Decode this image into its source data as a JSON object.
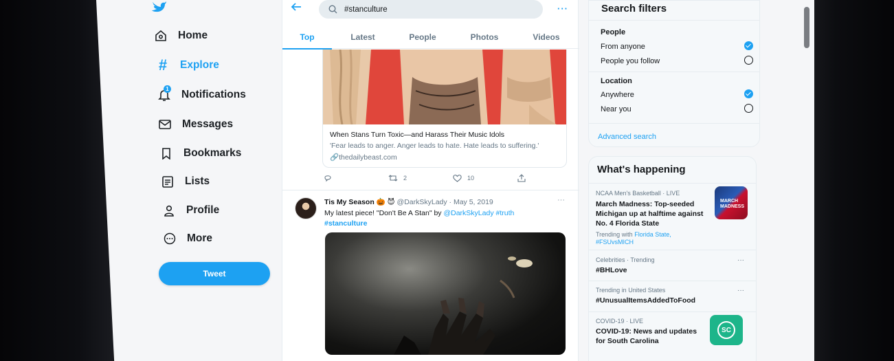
{
  "brand": {
    "accent": "#1da1f2",
    "logo_icon": "twitter-bird-icon"
  },
  "nav": {
    "items": [
      {
        "label": "Home",
        "icon": "home-icon"
      },
      {
        "label": "Explore",
        "icon": "hashtag-icon"
      },
      {
        "label": "Notifications",
        "icon": "bell-icon",
        "badge": "1"
      },
      {
        "label": "Messages",
        "icon": "envelope-icon"
      },
      {
        "label": "Bookmarks",
        "icon": "bookmark-icon"
      },
      {
        "label": "Lists",
        "icon": "list-icon"
      },
      {
        "label": "Profile",
        "icon": "person-icon"
      },
      {
        "label": "More",
        "icon": "more-circle-icon"
      }
    ],
    "tweet_label": "Tweet"
  },
  "search": {
    "value": "#stanculture",
    "more": "···"
  },
  "tabs": [
    {
      "label": "Top",
      "active": true
    },
    {
      "label": "Latest"
    },
    {
      "label": "People"
    },
    {
      "label": "Photos"
    },
    {
      "label": "Videos"
    }
  ],
  "card": {
    "title": "When Stans Turn Toxic—and Harass Their Music Idols",
    "description": "'Fear leads to anger. Anger leads to hate. Hate leads to suffering.'",
    "link": "thedailybeast.com"
  },
  "actions": {
    "retweets": "2",
    "likes": "10"
  },
  "tweet": {
    "name": "Tis My Season 🎃 😈",
    "handle_date": "@DarkSkyLady · May 5, 2019",
    "more": "···",
    "text_prefix": "My latest piece! \"Don't Be A Stan\" by ",
    "mention": "@DarkSkyLady",
    "hashtag_inline": "#truth",
    "hashtag_line": "#stanculture"
  },
  "filters": {
    "title": "Search filters",
    "people_label": "People",
    "people_options": [
      "From anyone",
      "People you follow"
    ],
    "location_label": "Location",
    "location_options": [
      "Anywhere",
      "Near you"
    ],
    "advanced": "Advanced search"
  },
  "whats": {
    "title": "What's happening",
    "t1": {
      "meta": "NCAA Men's Basketball · LIVE",
      "title_lines": [
        "March Madness: Top-seeded",
        "Michigan up at halftime against",
        "No. 4 Florida State"
      ],
      "sub_prefix": "Trending with ",
      "sub_link1": "Florida State,",
      "sub_link2": "#FSUvsMICH",
      "thumb_text": "MARCH MADNESS"
    },
    "t2": {
      "meta": "Celebrities · Trending",
      "title": "#BHLove",
      "dots": "···"
    },
    "t3": {
      "meta": "Trending in United States",
      "title": "#UnusualItemsAddedToFood",
      "dots": "···"
    },
    "t4": {
      "meta": "COVID-19 · LIVE",
      "title_lines": [
        "COVID-19: News and updates",
        "for South Carolina"
      ],
      "thumb_text": "SC"
    }
  }
}
